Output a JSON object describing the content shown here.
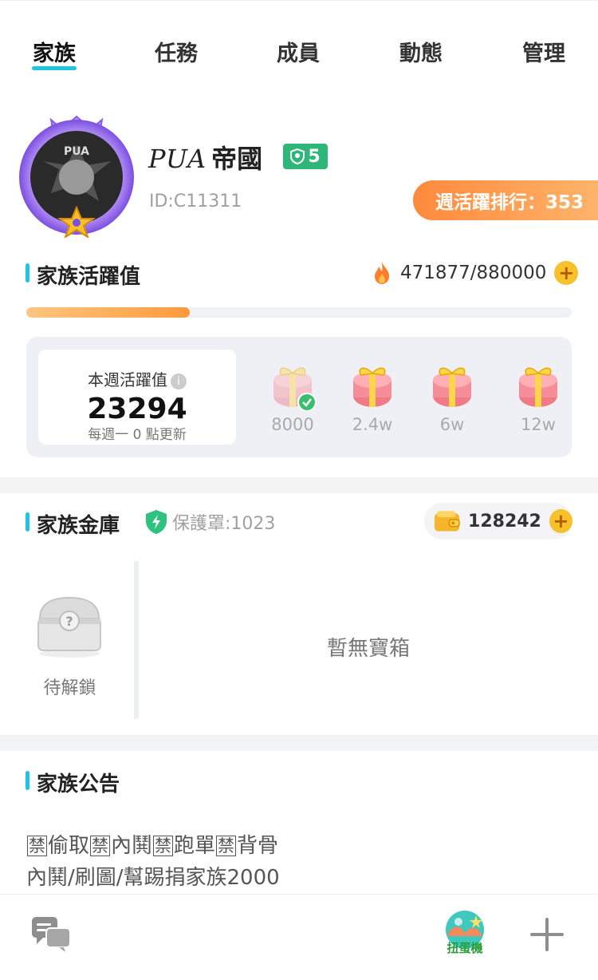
{
  "tabs": [
    {
      "label": "家族",
      "active": true
    },
    {
      "label": "任務",
      "active": false
    },
    {
      "label": "成員",
      "active": false
    },
    {
      "label": "動態",
      "active": false
    },
    {
      "label": "管理",
      "active": false
    }
  ],
  "family": {
    "name_latin": "PUA",
    "name_cjk": "帝國",
    "level": "5",
    "id": "ID:C11311",
    "weekly_rank": "週活躍排行：353",
    "avatar_text": "PUA"
  },
  "activity": {
    "title": "家族活躍值",
    "value": "471877/880000",
    "progress_fraction": 0.3
  },
  "weekly": {
    "label": "本週活躍值",
    "value": "23294",
    "note": "每週一 0 點更新",
    "rewards": [
      {
        "label": "8000",
        "claimed": true
      },
      {
        "label": "2.4w",
        "claimed": false
      },
      {
        "label": "6w",
        "claimed": false
      },
      {
        "label": "12w",
        "claimed": false
      }
    ]
  },
  "vault": {
    "title": "家族金庫",
    "shield_text": "保護罩:1023",
    "coins": "128242",
    "chest_label": "待解鎖",
    "empty_text": "暫無寶箱"
  },
  "announcement": {
    "title": "家族公告",
    "ban_word": "禁",
    "line1_parts": [
      "偷取",
      "內鬨",
      "跑單",
      "背骨"
    ],
    "line2": "內鬨/刷圖/幫踢捐家族2000"
  },
  "bottom": {
    "gacha_label": "扭蛋機"
  },
  "colors": {
    "accent": "#1ec4e2",
    "orange": "#ff9a3a",
    "gold": "#f6c12b",
    "green": "#2fb77a"
  }
}
